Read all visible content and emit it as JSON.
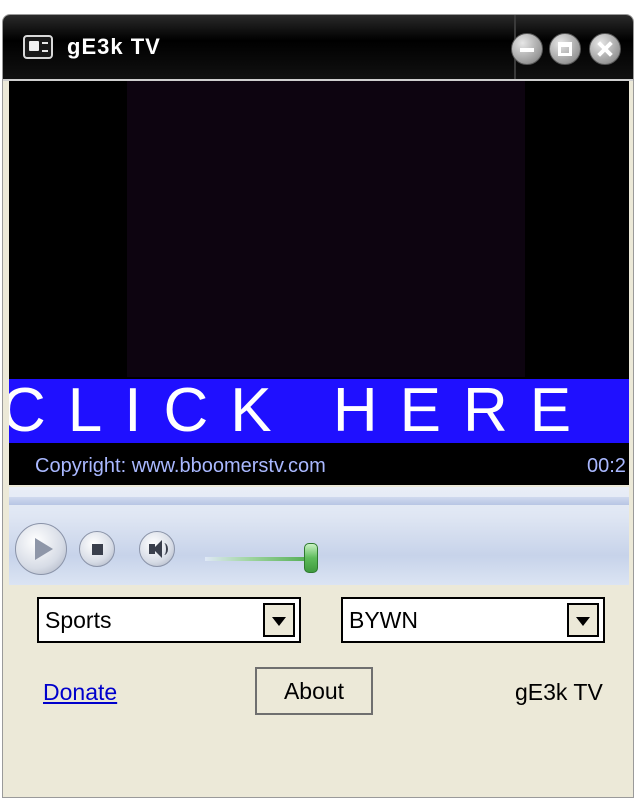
{
  "window": {
    "title": "gE3k TV",
    "controls": [
      "minimize",
      "maximize",
      "close"
    ]
  },
  "video": {
    "banner_text": "CLICK HERE",
    "copyright_text": "Copyright: www.bboomerstv.com",
    "timecode": "00:2"
  },
  "player": {
    "volume_level": 0.9
  },
  "selectors": {
    "genre": "Sports",
    "channel": "BYWN"
  },
  "footer": {
    "donate_label": "Donate",
    "about_label": "About",
    "brand_label": "gE3k TV"
  },
  "colors": {
    "banner": "#1f10ff",
    "status_text": "#a9b8ff",
    "link": "#0000cc"
  }
}
